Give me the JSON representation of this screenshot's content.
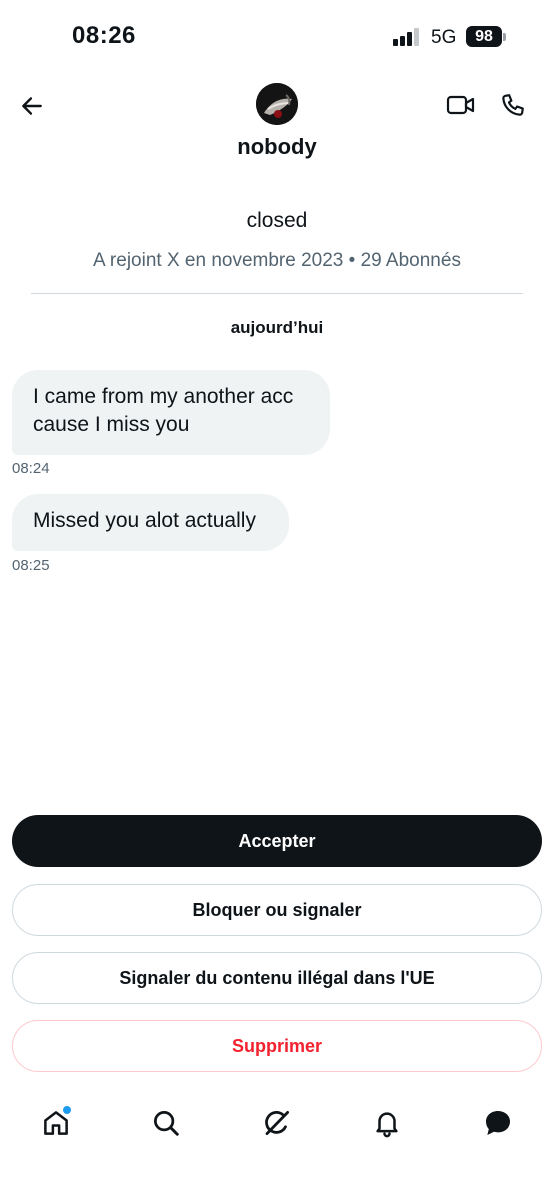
{
  "status_bar": {
    "time": "08:26",
    "network": "5G",
    "battery": "98"
  },
  "header": {
    "back_icon": "arrow-left-icon",
    "name": "nobody",
    "video_icon": "video-camera-icon",
    "call_icon": "phone-icon"
  },
  "profile": {
    "bio": "closed",
    "meta": "A rejoint X en novembre 2023 • 29 Abonnés"
  },
  "conversation": {
    "date_separator": "aujourd’hui",
    "messages": [
      {
        "text": "I came from my another acc cause I miss you",
        "time": "08:24"
      },
      {
        "text": "Missed you alot actually",
        "time": "08:25"
      }
    ]
  },
  "actions": {
    "accept": "Accepter",
    "block_report": "Bloquer ou signaler",
    "report_illegal": "Signaler du contenu illégal dans l'UE",
    "delete": "Supprimer"
  },
  "bottom_nav": {
    "items": [
      "home-icon",
      "search-icon",
      "grok-icon",
      "notifications-bell-icon",
      "messages-icon"
    ],
    "home_has_badge": true
  },
  "colors": {
    "text_primary": "#0f1419",
    "text_secondary": "#536471",
    "bubble_bg": "#eff3f4",
    "accent_blue": "#1d9bf0",
    "danger_red": "#f4212e"
  }
}
